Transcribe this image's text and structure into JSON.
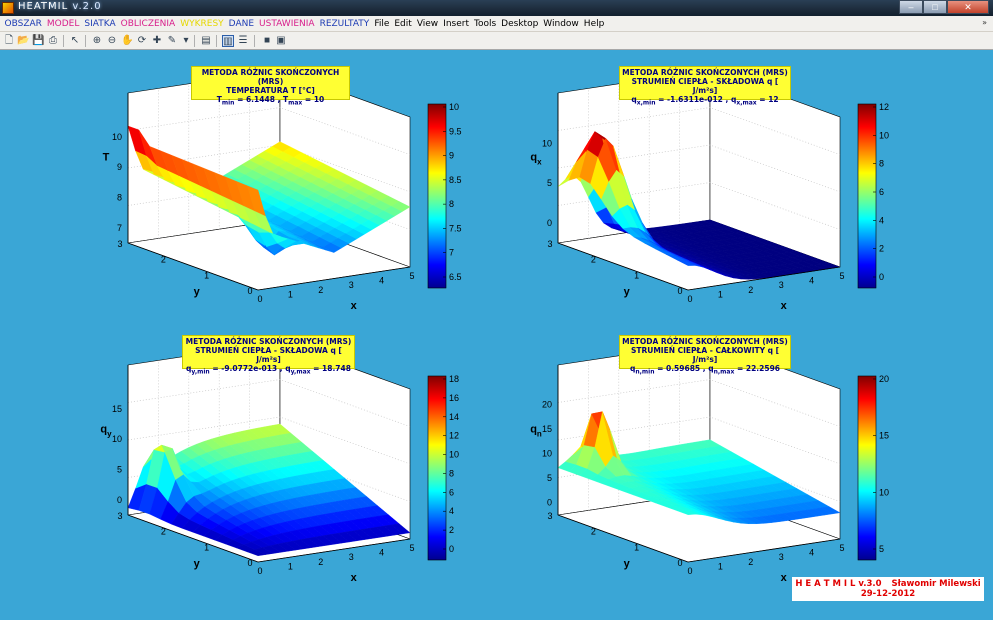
{
  "window": {
    "title": "HEATMIL",
    "version": "v.2.0",
    "buttons": [
      "–",
      "□",
      "✕"
    ]
  },
  "menu": [
    {
      "label": "OBSZAR",
      "color": "#1e3cb4"
    },
    {
      "label": "MODEL",
      "color": "#d8208c"
    },
    {
      "label": "SIATKA",
      "color": "#1e3cb4"
    },
    {
      "label": "OBLICZENIA",
      "color": "#d8208c"
    },
    {
      "label": "WYKRESY",
      "color": "#e6d800"
    },
    {
      "label": "DANE",
      "color": "#1e3cb4"
    },
    {
      "label": "USTAWIENIA",
      "color": "#d8208c"
    },
    {
      "label": "REZULTATY",
      "color": "#1e3cb4"
    },
    {
      "label": "File",
      "color": "#000000"
    },
    {
      "label": "Edit",
      "color": "#000000"
    },
    {
      "label": "View",
      "color": "#000000"
    },
    {
      "label": "Insert",
      "color": "#000000"
    },
    {
      "label": "Tools",
      "color": "#000000"
    },
    {
      "label": "Desktop",
      "color": "#000000"
    },
    {
      "label": "Window",
      "color": "#000000"
    },
    {
      "label": "Help",
      "color": "#000000"
    }
  ],
  "toolbar": [
    "new-file-icon",
    "open-folder-icon",
    "save-icon",
    "print-icon",
    "pointer-icon",
    "zoom-in-icon",
    "zoom-out-icon",
    "pan-hand-icon",
    "rotate-3d-icon",
    "data-cursor-icon",
    "brush-icon",
    "link-icon",
    "colorbar-icon",
    "legend-icon",
    "hide-tools-icon",
    "show-tools-icon"
  ],
  "plots": [
    {
      "title": [
        "METODA RÓŻNIC SKOŃCZONYCH (MRS)",
        "TEMPERATURA T [°C]"
      ],
      "minmax": {
        "min_label": "T",
        "min_sub": "min",
        "min_value": "6.1448",
        "max_label": "T",
        "max_sub": "max",
        "max_value": "10"
      },
      "zlabel": "T",
      "zlabel_sub": "",
      "ztick_labels": [
        "7",
        "8",
        "9",
        "10"
      ],
      "colorbar_ticks": [
        "10",
        "9.5",
        "9",
        "8.5",
        "8",
        "7.5",
        "7",
        "6.5"
      ]
    },
    {
      "title": [
        "METODA RÓŻNIC SKOŃCZONYCH (MRS)",
        "STRUMIEŃ CIEPŁA - SKŁADOWA q [ J/m²s]"
      ],
      "minmax": {
        "min_label": "q",
        "min_sub": "x,min",
        "min_value": "-1.6311e-012",
        "max_label": "q",
        "max_sub": "x,max",
        "max_value": "12"
      },
      "zlabel": "q",
      "zlabel_sub": "x",
      "ztick_labels": [
        "0",
        "5",
        "10"
      ],
      "colorbar_ticks": [
        "12",
        "10",
        "8",
        "6",
        "4",
        "2",
        "0"
      ]
    },
    {
      "title": [
        "METODA RÓŻNIC SKOŃCZONYCH (MRS)",
        "STRUMIEŃ CIEPŁA - SKŁADOWA q [ J/m²s]"
      ],
      "minmax": {
        "min_label": "q",
        "min_sub": "y,min",
        "min_value": "-9.0772e-013",
        "max_label": "q",
        "max_sub": "y,max",
        "max_value": "18.748"
      },
      "zlabel": "q",
      "zlabel_sub": "y",
      "ztick_labels": [
        "0",
        "5",
        "10",
        "15"
      ],
      "colorbar_ticks": [
        "18",
        "16",
        "14",
        "12",
        "10",
        "8",
        "6",
        "4",
        "2",
        "0"
      ]
    },
    {
      "title": [
        "METODA RÓŻNIC SKOŃCZONYCH (MRS)",
        "STRUMIEŃ CIEPŁA - CAŁKOWITY q [ J/m²s]"
      ],
      "minmax": {
        "min_label": "q",
        "min_sub": "n,min",
        "min_value": "0.59685",
        "max_label": "q",
        "max_sub": "n,max",
        "max_value": "22.2596"
      },
      "zlabel": "q",
      "zlabel_sub": "n",
      "ztick_labels": [
        "0",
        "5",
        "10",
        "15",
        "20"
      ],
      "colorbar_ticks": [
        "20",
        "15",
        "10",
        "5"
      ]
    }
  ],
  "xticks": [
    "0",
    "1",
    "2",
    "3",
    "4",
    "5"
  ],
  "yticks": [
    "3",
    "2",
    "1",
    "0"
  ],
  "xlabel": "x",
  "ylabel": "y",
  "credit": {
    "line1": "H E A T M I L v.3.0",
    "author": "Sławomir Milewski",
    "date": "29-12-2012"
  }
}
